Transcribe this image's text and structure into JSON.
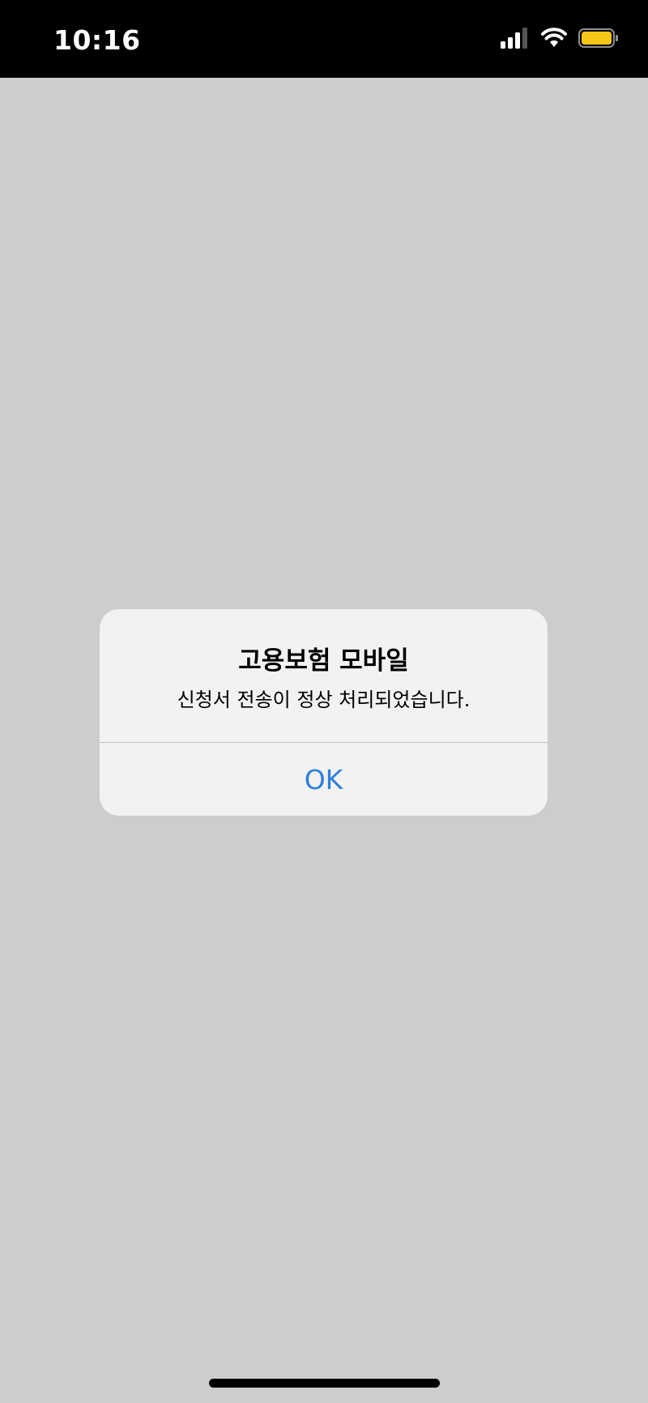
{
  "status_bar": {
    "time": "10:16",
    "icons": [
      "cellular-signal-icon",
      "wifi-icon",
      "battery-icon"
    ],
    "battery_color": "#f5c518"
  },
  "alert": {
    "title": "고용보험 모바일",
    "message": "신청서 전송이 정상 처리되었습니다.",
    "ok_label": "OK",
    "button_color": "#2f7fdc"
  },
  "colors": {
    "backdrop": "#cdcdcd",
    "status_bar_bg": "#000000",
    "alert_bg": "#f2f2f2"
  }
}
